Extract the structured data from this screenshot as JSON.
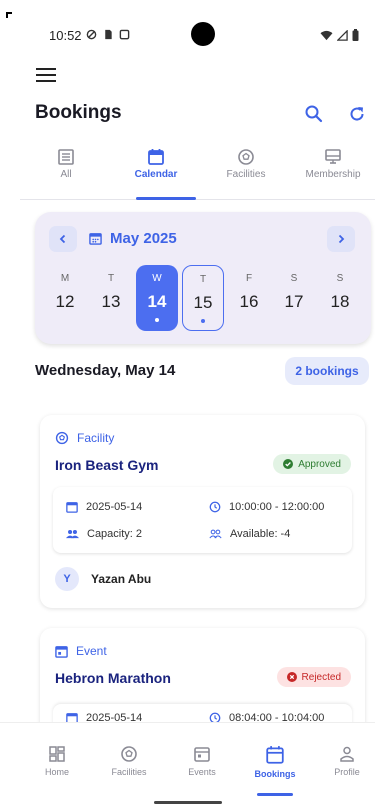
{
  "status_bar": {
    "time": "10:52"
  },
  "header": {
    "title": "Bookings"
  },
  "tabs": [
    {
      "label": "All",
      "icon": "list-icon"
    },
    {
      "label": "Calendar",
      "icon": "calendar-icon",
      "active": true
    },
    {
      "label": "Facilities",
      "icon": "soccer-ball-icon"
    },
    {
      "label": "Membership",
      "icon": "card-icon"
    }
  ],
  "calendar": {
    "month_label": "May 2025",
    "days": [
      {
        "name": "M",
        "date": "12"
      },
      {
        "name": "T",
        "date": "13"
      },
      {
        "name": "W",
        "date": "14",
        "selected": true,
        "has_events": true
      },
      {
        "name": "T",
        "date": "15",
        "today": true,
        "has_events": true
      },
      {
        "name": "F",
        "date": "16"
      },
      {
        "name": "S",
        "date": "17"
      },
      {
        "name": "S",
        "date": "18"
      }
    ]
  },
  "day_summary": {
    "heading": "Wednesday, May 14",
    "count_label": "2 bookings"
  },
  "bookings": [
    {
      "type": "Facility",
      "title": "Iron Beast Gym",
      "status": "Approved",
      "date": "2025-05-14",
      "time": "10:00:00 - 12:00:00",
      "capacity": "Capacity: 2",
      "available": "Available: -4",
      "user_initial": "Y",
      "user_name": "Yazan Abu"
    },
    {
      "type": "Event",
      "title": "Hebron Marathon",
      "status": "Rejected",
      "date": "2025-05-14",
      "time": "08:04:00 - 10:04:00"
    }
  ],
  "bottom_nav": [
    {
      "label": "Home",
      "icon": "grid-icon"
    },
    {
      "label": "Facilities",
      "icon": "soccer-ball-icon"
    },
    {
      "label": "Events",
      "icon": "event-calendar-icon"
    },
    {
      "label": "Bookings",
      "icon": "calendar-icon",
      "active": true
    },
    {
      "label": "Profile",
      "icon": "person-icon"
    }
  ],
  "colors": {
    "accent": "#3e63e6",
    "approved": "#2e7d32",
    "rejected": "#c62828",
    "calendar_bg": "#efecf8"
  }
}
